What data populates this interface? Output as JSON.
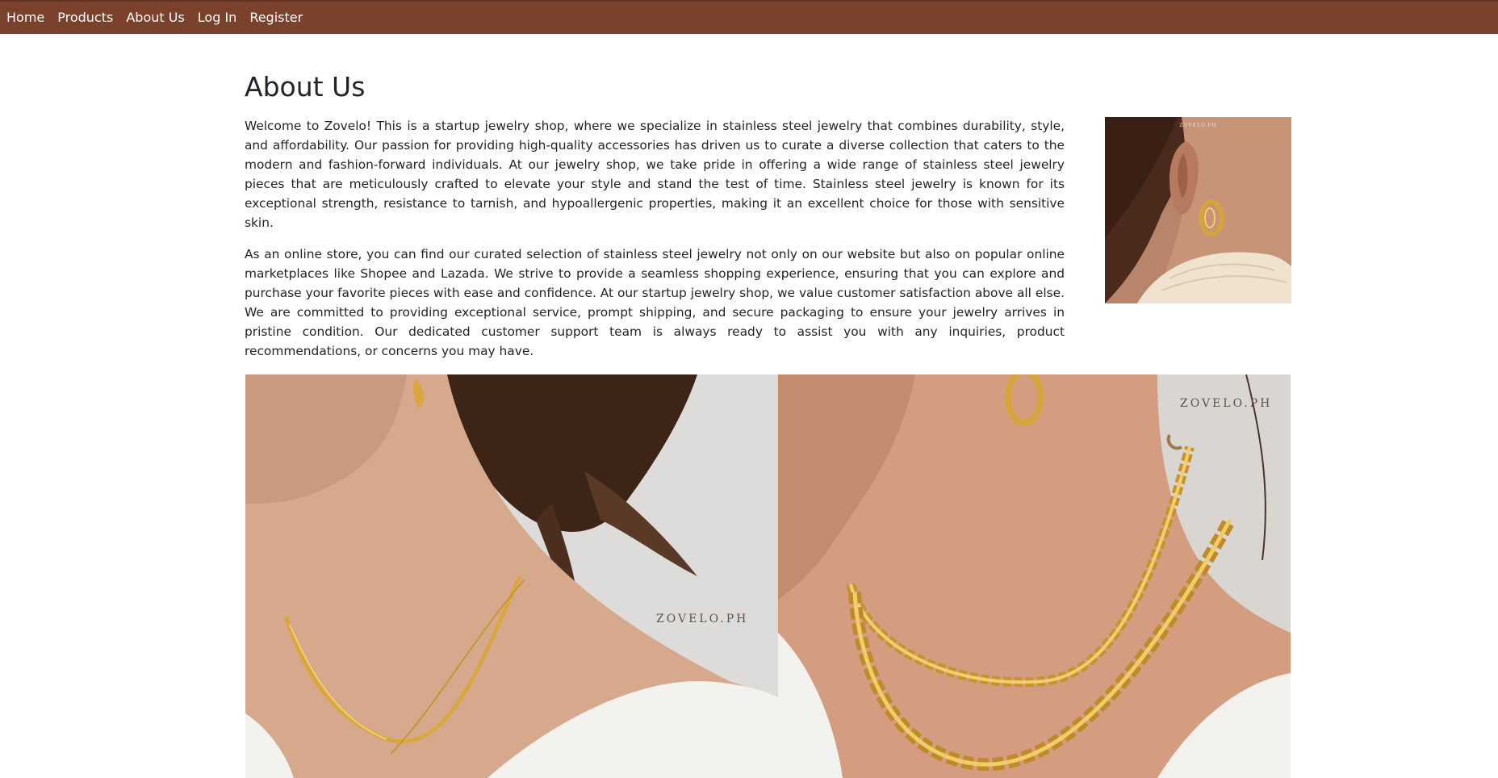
{
  "nav": {
    "items": [
      {
        "label": "Home"
      },
      {
        "label": "Products"
      },
      {
        "label": "About Us"
      },
      {
        "label": "Log In"
      },
      {
        "label": "Register"
      }
    ]
  },
  "about": {
    "title": "About Us",
    "paragraphs": [
      "Welcome to Zovelo! This is a startup jewelry shop, where we specialize in stainless steel jewelry that combines durability, style, and affordability. Our passion for providing high-quality accessories has driven us to curate a diverse collection that caters to the modern and fashion-forward individuals. At our jewelry shop, we take pride in offering a wide range of stainless steel jewelry pieces that are meticulously crafted to elevate your style and stand the test of time. Stainless steel jewelry is known for its exceptional strength, resistance to tarnish, and hypoallergenic properties, making it an excellent choice for those with sensitive skin.",
      "As an online store, you can find our curated selection of stainless steel jewelry not only on our website but also on popular online marketplaces like Shopee and Lazada. We strive to provide a seamless shopping experience, ensuring that you can explore and purchase your favorite pieces with ease and confidence. At our startup jewelry shop, we value customer satisfaction above all else. We are committed to providing exceptional service, prompt shipping, and secure packaging to ensure your jewelry arrives in pristine condition. Our dedicated customer support team is always ready to assist you with any inquiries, product recommendations, or concerns you may have."
    ]
  },
  "images": {
    "side_watermark": "ZOVELO.PH",
    "left_watermark": "ZOVELO.PH",
    "right_watermark": "ZOVELO.PH"
  },
  "colors": {
    "navbar": "#7a412d",
    "gold": "#d4a23a"
  }
}
